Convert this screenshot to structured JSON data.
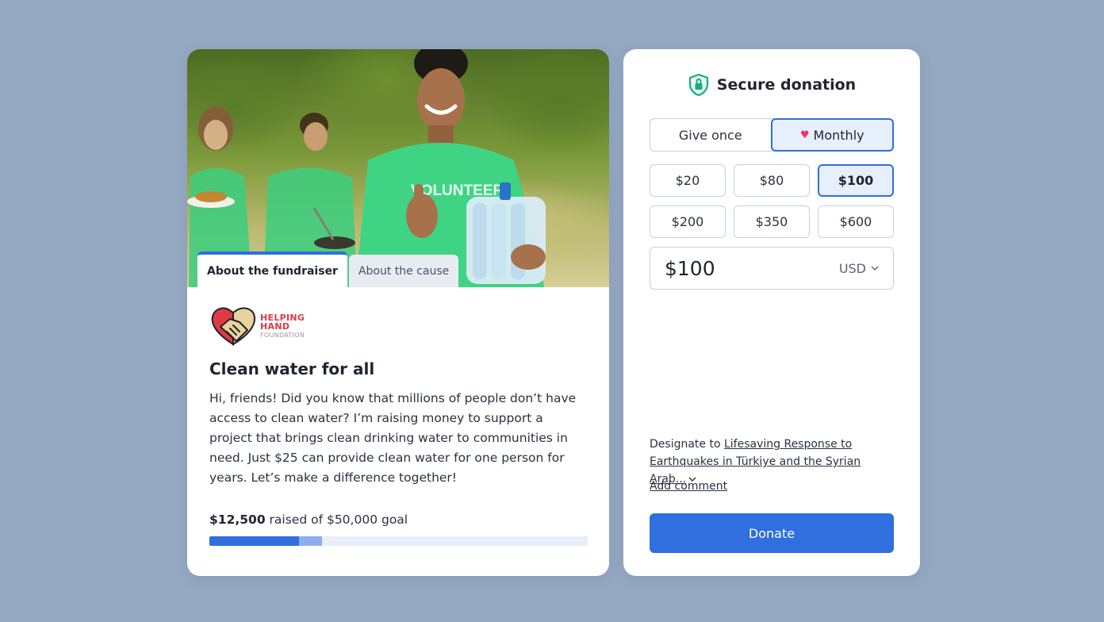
{
  "fundraiser": {
    "tabs": [
      {
        "label": "About the fundraiser",
        "active": true
      },
      {
        "label": "About the cause",
        "active": false
      }
    ],
    "photo": {
      "shirt_text": "VOLUNTEER",
      "description_icon": "volunteers-photo"
    },
    "org_logo": {
      "line1": "HELPING",
      "line2": "HAND",
      "line3": "FOUNDATION",
      "icon": "handshake-heart-icon"
    },
    "title": "Clean water for all",
    "description": "Hi, friends! Did you know that millions of people don’t have access to  clean water? I’m raising money to support a project that brings clean drinking water to communities in need. Just $25 can provide clean water for one person for years. Let’s make a difference together!",
    "raised_amount": "$12,500",
    "raised_suffix": " raised of $50,000 goal",
    "progress": {
      "raised_fraction": 0.236,
      "pending_fraction": 0.061
    }
  },
  "donation": {
    "header": {
      "title": "Secure donation",
      "icon": "shield-lock-icon"
    },
    "frequency": {
      "give_once": "Give once",
      "monthly": "Monthly",
      "selected": "monthly"
    },
    "amounts": [
      "$20",
      "$80",
      "$100",
      "$200",
      "$350",
      "$600"
    ],
    "selected_amount_index": 2,
    "amount_value": "$100",
    "currency": "USD",
    "designate_prefix": "Designate to ",
    "designate_link_line1": "Lifesaving Response to",
    "designate_link_line2": "Earthquakes in Türkiye and the Syrian Arab...",
    "add_comment": "Add comment",
    "donate_label": "Donate"
  },
  "colors": {
    "background": "#95a8c2",
    "accent": "#2f6fde",
    "accent_light": "#e8effc",
    "heart": "#e8356d",
    "shield": "#1aaa7e",
    "brand_red": "#e03a48"
  }
}
